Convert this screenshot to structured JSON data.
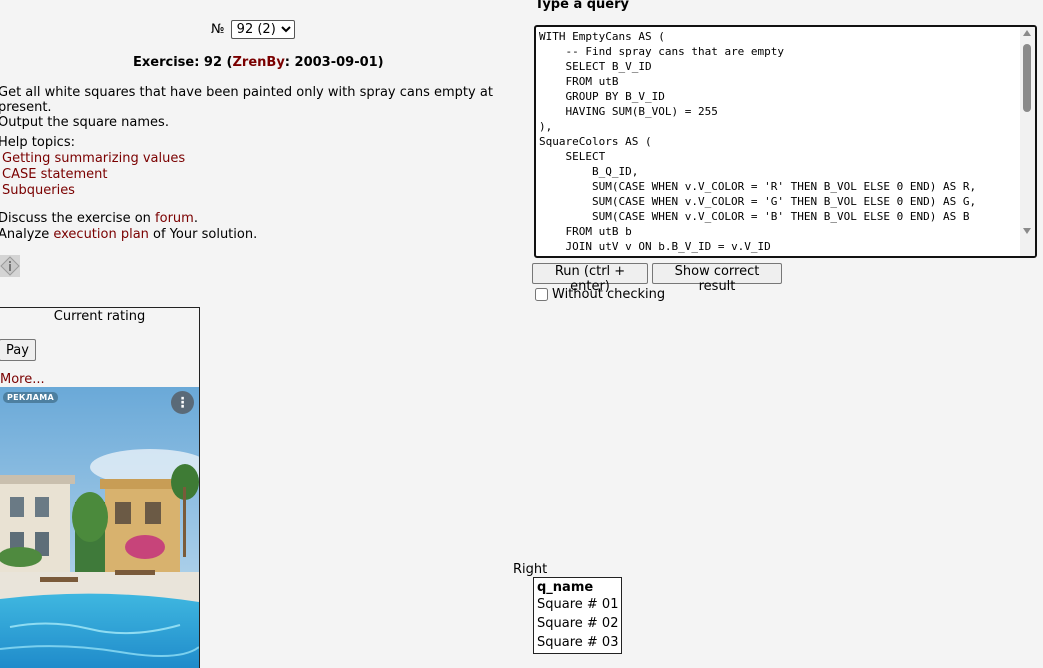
{
  "exercise_select": {
    "prefix": "№",
    "selected": "92 (2)"
  },
  "exercise": {
    "title_prefix": "Exercise: 92 (",
    "author": "ZrenBy",
    "title_suffix": ": 2003-09-01)",
    "task_line1": "Get all white squares that have been painted only with spray cans empty at present.",
    "task_line2": "Output the square names."
  },
  "help": {
    "label": "Help topics:",
    "topics": [
      "Getting summarizing values",
      "CASE statement",
      "Subqueries"
    ]
  },
  "discuss": {
    "line1_prefix": "Discuss the exercise on ",
    "forum_link": "forum",
    "line1_suffix": ".",
    "line2_prefix": "Analyze ",
    "plan_link": "execution plan",
    "line2_suffix": " of Your solution."
  },
  "rating": {
    "title": "Current rating",
    "pay_label": "Pay",
    "more_label": "More...",
    "ad_badge": "РЕКЛАМА",
    "ad_menu": "⋮"
  },
  "query": {
    "label": "Type a query",
    "code": "WITH EmptyCans AS (\n    -- Find spray cans that are empty\n    SELECT B_V_ID\n    FROM utB\n    GROUP BY B_V_ID\n    HAVING SUM(B_VOL) = 255\n),\nSquareColors AS (\n    SELECT\n        B_Q_ID,\n        SUM(CASE WHEN v.V_COLOR = 'R' THEN B_VOL ELSE 0 END) AS R,\n        SUM(CASE WHEN v.V_COLOR = 'G' THEN B_VOL ELSE 0 END) AS G,\n        SUM(CASE WHEN v.V_COLOR = 'B' THEN B_VOL ELSE 0 END) AS B\n    FROM utB b\n    JOIN utV v ON b.B_V_ID = v.V_ID\n    GROUP BY B_Q_ID\n)"
  },
  "buttons": {
    "run": "Run (ctrl + enter)",
    "show_correct": "Show correct result",
    "without_checking": "Without checking"
  },
  "result": {
    "label": "Right",
    "column": "q_name",
    "rows": [
      "Square # 01",
      "Square # 02",
      "Square # 03"
    ]
  },
  "colors": {
    "link": "#7a0000",
    "page_bg": "#f4f4f4",
    "ad_badge_bg": "#4d7fa0"
  }
}
